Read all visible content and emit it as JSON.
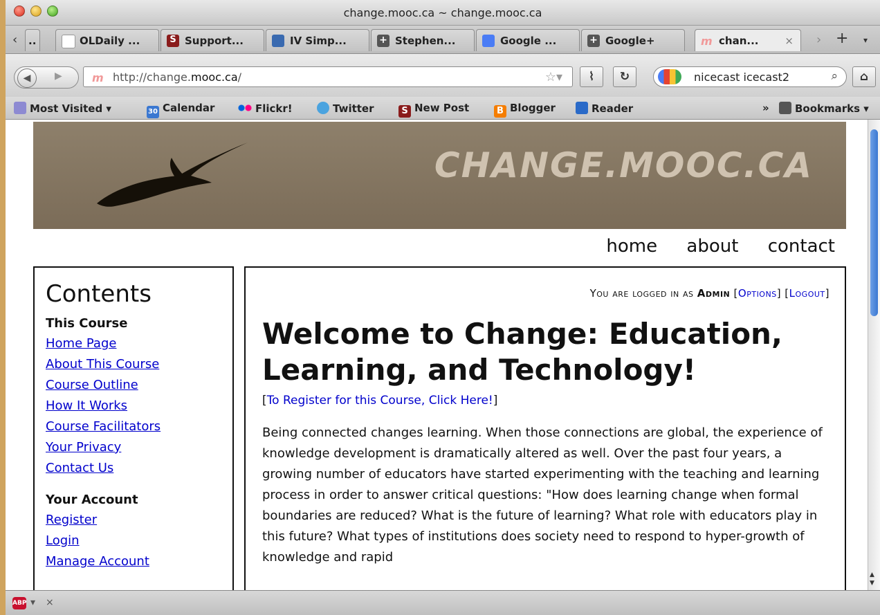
{
  "window": {
    "title": "change.mooc.ca ~ change.mooc.ca"
  },
  "tabs": [
    {
      "label": "OLDaily ...",
      "icon": "page-icon"
    },
    {
      "label": "Support...",
      "icon": "s-icon"
    },
    {
      "label": "IV Simp...",
      "icon": "app-icon"
    },
    {
      "label": "Stephen...",
      "icon": "google-plus-icon"
    },
    {
      "label": "Google ...",
      "icon": "translate-icon"
    },
    {
      "label": "Google+",
      "icon": "google-plus-icon"
    },
    {
      "label": "chan...",
      "icon": "mooc-icon",
      "active": true
    }
  ],
  "nav": {
    "url_prefix": "http://change.",
    "url_domain": "mooc.ca",
    "url_suffix": "/",
    "search_value": "nicecast icecast2"
  },
  "bookmarks": [
    {
      "label": "Most Visited ▾",
      "icon": "most-visited-icon"
    },
    {
      "label": "Calendar",
      "icon": "calendar-icon",
      "badge": "30"
    },
    {
      "label": "Flickr!",
      "icon": "flickr-icon"
    },
    {
      "label": "Twitter",
      "icon": "twitter-icon"
    },
    {
      "label": "New Post",
      "icon": "s-icon"
    },
    {
      "label": "Blogger",
      "icon": "blogger-icon"
    },
    {
      "label": "Reader",
      "icon": "reader-icon"
    }
  ],
  "bookmarks_menu": "Bookmarks ▾",
  "site": {
    "banner_title": "CHANGE.MOOC.CA",
    "topnav": [
      "home",
      "about",
      "contact"
    ]
  },
  "sidebar": {
    "heading": "Contents",
    "course_heading": "This Course",
    "course_links": [
      "Home Page",
      "About This Course",
      "Course Outline",
      "How It Works",
      "Course Facilitators",
      "Your Privacy",
      "Contact Us"
    ],
    "account_heading": "Your Account",
    "account_links": [
      "Register",
      "Login",
      "Manage Account"
    ]
  },
  "main": {
    "login_prefix": "You are logged in as ",
    "login_user": "Admin",
    "options_label": "Options",
    "logout_label": "Logout",
    "title": "Welcome to Change: Education, Learning, and Technology!",
    "register_link": "To Register for this Course, Click Here!",
    "body": "Being connected changes learning. When those connections are global, the experience of knowledge development is dramatically altered as well. Over the past four years, a growing number of educators have started experimenting with the teaching and learning process in order to answer critical questions: \"How does learning change when formal boundaries are reduced? What is the future of learning? What role with educators play in this future? What types of institutions does society need to respond to hyper-growth of knowledge and rapid"
  },
  "colors": {
    "link": "#0000cc",
    "banner": "#857662",
    "desktop": "#cfa45e"
  }
}
